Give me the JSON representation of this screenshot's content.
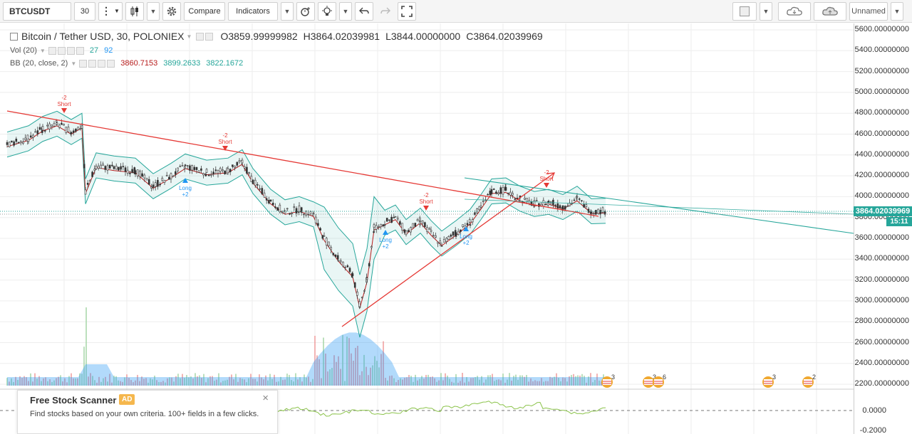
{
  "toolbar": {
    "symbol": "BTCUSDT",
    "interval": "30",
    "compare_label": "Compare",
    "indicators_label": "Indicators",
    "layout_name": "Unnamed"
  },
  "legend": {
    "title": "Bitcoin / Tether USD, 30, POLONIEX",
    "open": "O3859.99999982",
    "high": "H3864.02039981",
    "low": "L3844.00000000",
    "close": "C3864.02039969",
    "vol_label": "Vol (20)",
    "vol_v1": "27",
    "vol_v2": "92",
    "bb_label": "BB (20, close, 2)",
    "bb_v1": "3860.7153",
    "bb_v2": "3899.2633",
    "bb_v3": "3822.1672"
  },
  "price_scale": {
    "labels": [
      "5600.00000000",
      "5400.00000000",
      "5200.00000000",
      "5000.00000000",
      "4800.00000000",
      "4600.00000000",
      "4400.00000000",
      "4200.00000000",
      "4000.00000000",
      "3800.00000000",
      "3600.00000000",
      "3400.00000000",
      "3200.00000000",
      "3000.00000000",
      "2800.00000000",
      "2600.00000000",
      "2400.00000000",
      "2200.00000000"
    ],
    "current_price": "3864.02039969",
    "countdown": "15:11",
    "osc_labels": [
      "0.0000",
      "-0.2000"
    ]
  },
  "signals": [
    {
      "text": "-2",
      "sub": "Short",
      "dir": "short"
    },
    {
      "text": "-2",
      "sub": "Short",
      "dir": "short"
    },
    {
      "text": "-2",
      "sub": "Short",
      "dir": "short"
    },
    {
      "text": "-2",
      "sub": "Short",
      "dir": "short"
    },
    {
      "text": "Long",
      "sub": "+2",
      "dir": "long"
    },
    {
      "text": "Long",
      "sub": "+2",
      "dir": "long"
    },
    {
      "text": "Long",
      "sub": "+2",
      "dir": "long"
    }
  ],
  "events": [
    {
      "count": "3"
    },
    {
      "count": "3"
    },
    {
      "count": "6"
    },
    {
      "count": "3"
    },
    {
      "count": "2"
    }
  ],
  "ad": {
    "title": "Free Stock Scanner",
    "badge": "AD",
    "text": "Find stocks based on your own criteria. 100+ fields in a few clicks."
  },
  "colors": {
    "up": "#26a69a",
    "down": "#ef5350",
    "bb_band": "#26a69a",
    "bb_mid": "#b71c1c",
    "trendline": "#e53935",
    "channel": "#26a69a"
  }
}
